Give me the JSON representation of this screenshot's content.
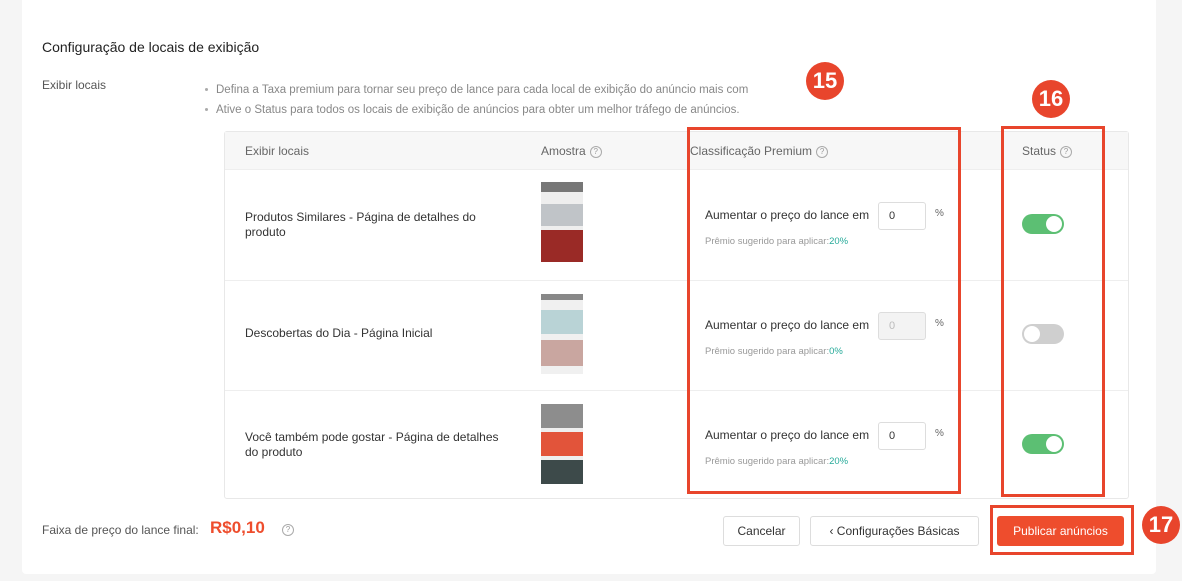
{
  "section": {
    "title": "Configuração de locais de exibição",
    "label": "Exibir locais",
    "hints": [
      "Defina a Taxa premium para tornar seu preço de lance para cada local de exibição do anúncio mais com",
      "Ative o Status para todos os locais de exibição de anúncios para obter um melhor tráfego de anúncios."
    ]
  },
  "table": {
    "headers": {
      "location": "Exibir locais",
      "sample": "Amostra",
      "premium": "Classificação Premium",
      "status": "Status"
    },
    "rows": [
      {
        "name": "Produtos Similares - Página de detalhes do produto",
        "lance_label": "Aumentar o preço do lance em",
        "value": "0",
        "unit": "%",
        "suggest_label": "Prêmio sugerido para aplicar:",
        "suggest_value": "20%",
        "status_on": true,
        "input_enabled": true
      },
      {
        "name": "Descobertas do Dia - Página Inicial",
        "lance_label": "Aumentar o preço do lance em",
        "value": "0",
        "unit": "%",
        "suggest_label": "Prêmio sugerido para aplicar:",
        "suggest_value": "0%",
        "status_on": false,
        "input_enabled": false
      },
      {
        "name": "Você também pode gostar - Página de detalhes do produto",
        "lance_label": "Aumentar o preço do lance em",
        "value": "0",
        "unit": "%",
        "suggest_label": "Prêmio sugerido para aplicar:",
        "suggest_value": "20%",
        "status_on": true,
        "input_enabled": true
      }
    ]
  },
  "footer": {
    "label": "Faixa de preço do lance final:",
    "price": "R$0,10",
    "cancel": "Cancelar",
    "back": "‹  Configurações Básicas",
    "publish": "Publicar anúncios"
  },
  "annotations": [
    "15",
    "16",
    "17"
  ],
  "colors": {
    "accent": "#ee4d2d",
    "toggle_on": "#5cbf73",
    "annotation": "#e8452c",
    "suggest": "#26aa99"
  }
}
